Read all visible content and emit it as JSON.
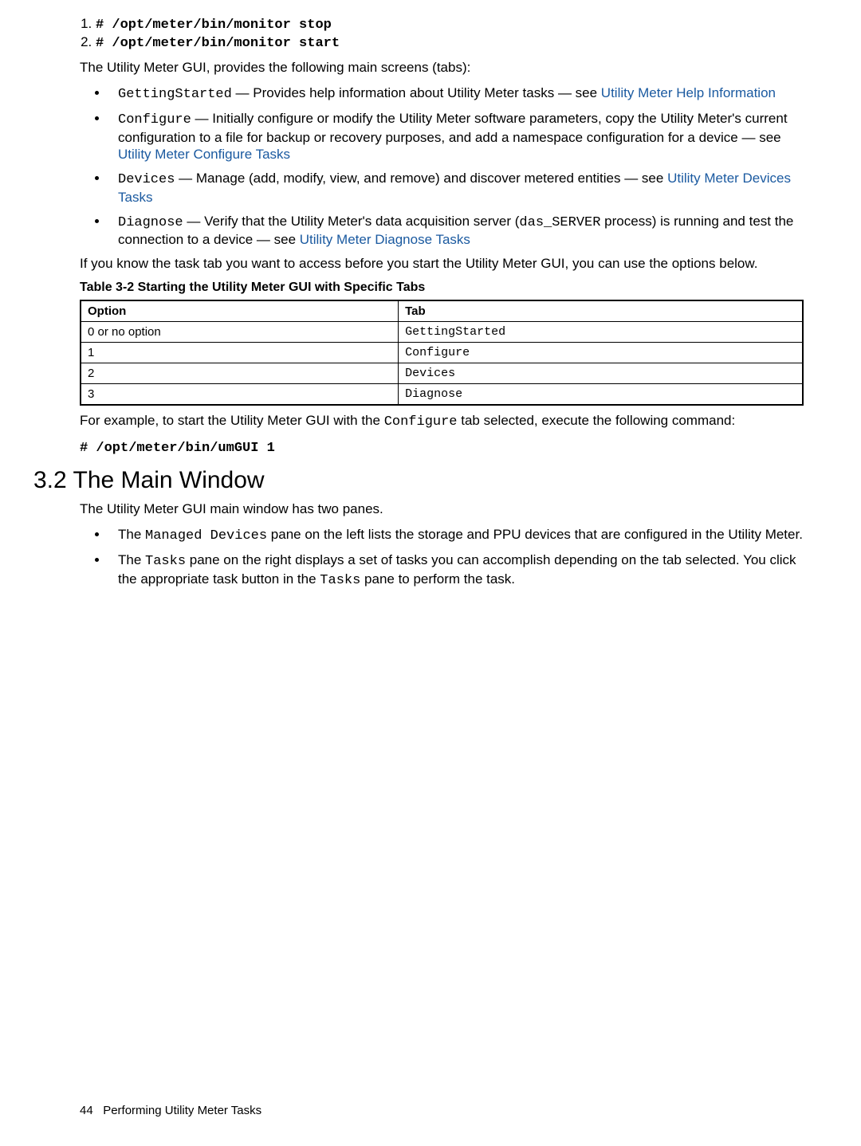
{
  "commands": {
    "stop": "# /opt/meter/bin/monitor stop",
    "start": "# /opt/meter/bin/monitor start"
  },
  "intro_main_screens": "The Utility Meter GUI, provides the following main screens (tabs):",
  "bullets_top": [
    {
      "code": "GettingStarted",
      "rest": " — Provides help information about Utility Meter tasks — see ",
      "link": "Utility Meter Help Information"
    },
    {
      "code": "Configure",
      "rest": " — Initially configure or modify the Utility Meter software parameters, copy the Utility Meter's current configuration to a file for backup or recovery purposes, and add a namespace configuration for a device — see ",
      "link": "Utility Meter Configure Tasks"
    },
    {
      "code": "Devices",
      "rest": " — Manage (add, modify, view, and remove) and discover metered entities — see ",
      "link": "Utility Meter Devices Tasks"
    },
    {
      "code": "Diagnose",
      "rest_pre": " — Verify that the Utility Meter's data acquisition server (",
      "inline_code": "das_SERVER",
      "rest_post": " process) is running and test the connection to a device — see ",
      "link": "Utility Meter Diagnose Tasks"
    }
  ],
  "task_tab_note": "If you know the task tab you want to access before you start the Utility Meter GUI, you can use the options below.",
  "table": {
    "title": "Table 3-2 Starting the Utility Meter GUI with Specific Tabs",
    "head": {
      "option": "Option",
      "tab": "Tab"
    },
    "rows": [
      {
        "option": "0 or no option",
        "tab": "GettingStarted"
      },
      {
        "option": "1",
        "tab": "Configure"
      },
      {
        "option": "2",
        "tab": "Devices"
      },
      {
        "option": "3",
        "tab": "Diagnose"
      }
    ]
  },
  "example": {
    "text_pre": "For example, to start the Utility Meter GUI with the ",
    "code": "Configure",
    "text_post": " tab selected, execute the following command:",
    "cmd": "# /opt/meter/bin/umGUI 1"
  },
  "section": {
    "title": "3.2 The Main Window",
    "intro": "The Utility Meter GUI main window has two panes.",
    "items": [
      {
        "pre": "The ",
        "code": "Managed Devices",
        "post": " pane on the left lists the storage and PPU devices that are configured in the Utility Meter."
      },
      {
        "pre": "The ",
        "code": "Tasks",
        "mid": " pane on the right displays a set of tasks you can accomplish depending on the tab selected. You click the appropriate task button in the ",
        "code2": "Tasks",
        "post": " pane to perform the task."
      }
    ]
  },
  "footer": {
    "page": "44",
    "label": "Performing Utility Meter Tasks"
  }
}
